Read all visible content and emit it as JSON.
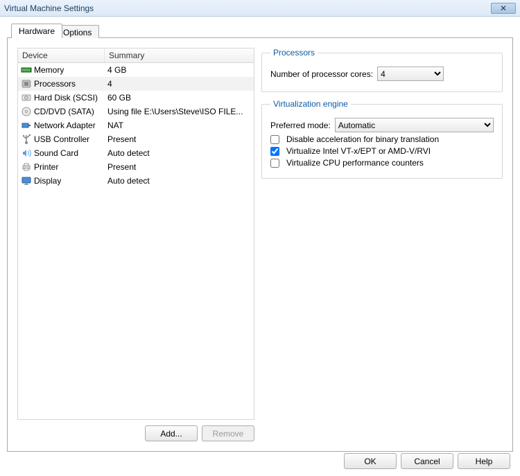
{
  "window": {
    "title": "Virtual Machine Settings"
  },
  "tabs": {
    "hardware": "Hardware",
    "options": "Options"
  },
  "table": {
    "headers": {
      "device": "Device",
      "summary": "Summary"
    },
    "rows": [
      {
        "icon": "memory-icon",
        "device": "Memory",
        "summary": "4 GB"
      },
      {
        "icon": "cpu-icon",
        "device": "Processors",
        "summary": "4"
      },
      {
        "icon": "hdd-icon",
        "device": "Hard Disk (SCSI)",
        "summary": "60 GB"
      },
      {
        "icon": "cd-icon",
        "device": "CD/DVD (SATA)",
        "summary": "Using file E:\\Users\\Steve\\ISO FILE..."
      },
      {
        "icon": "net-icon",
        "device": "Network Adapter",
        "summary": "NAT"
      },
      {
        "icon": "usb-icon",
        "device": "USB Controller",
        "summary": "Present"
      },
      {
        "icon": "sound-icon",
        "device": "Sound Card",
        "summary": "Auto detect"
      },
      {
        "icon": "printer-icon",
        "device": "Printer",
        "summary": "Present"
      },
      {
        "icon": "display-icon",
        "device": "Display",
        "summary": "Auto detect"
      }
    ]
  },
  "buttons": {
    "add": "Add...",
    "remove": "Remove",
    "ok": "OK",
    "cancel": "Cancel",
    "help": "Help"
  },
  "processors": {
    "legend": "Processors",
    "cores_label": "Number of processor cores:",
    "cores_value": "4"
  },
  "virt": {
    "legend": "Virtualization engine",
    "mode_label": "Preferred mode:",
    "mode_value": "Automatic",
    "cb_disable_accel": "Disable acceleration for binary translation",
    "cb_vt": "Virtualize Intel VT-x/EPT or AMD-V/RVI",
    "cb_perf": "Virtualize CPU performance counters",
    "checked": {
      "disable_accel": false,
      "vt": true,
      "perf": false
    }
  },
  "selected_row": 1
}
